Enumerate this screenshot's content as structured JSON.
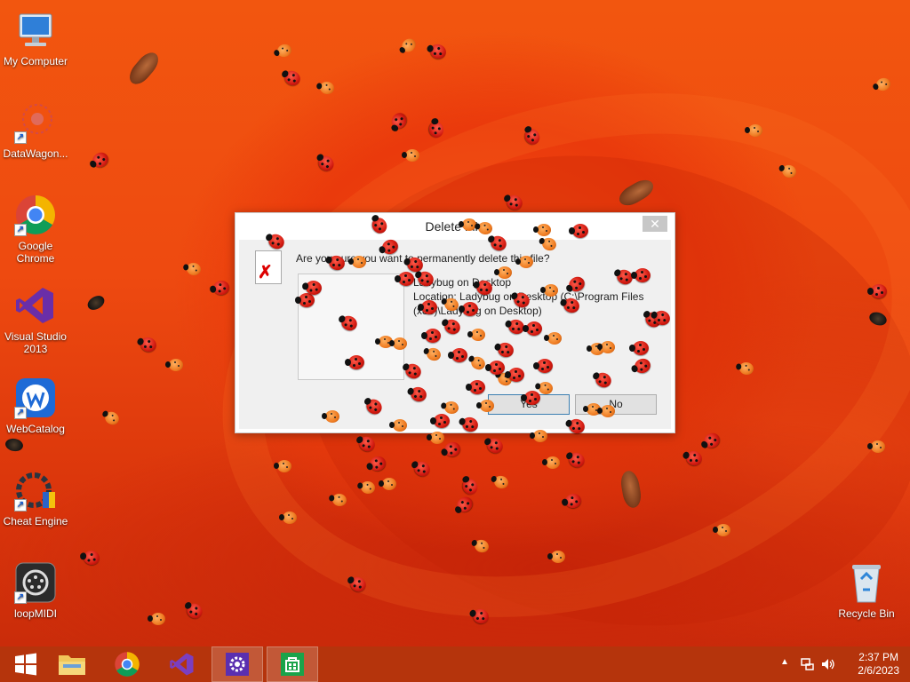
{
  "desktop": {
    "icons": [
      {
        "label": "My Computer",
        "icon": "computer-icon"
      },
      {
        "label": "DataWagon...",
        "icon": "datawagon-icon"
      },
      {
        "label": "Google Chrome",
        "icon": "chrome-icon"
      },
      {
        "label": "Visual Studio 2013",
        "icon": "visual-studio-icon"
      },
      {
        "label": "WebCatalog",
        "icon": "webcatalog-icon"
      },
      {
        "label": "Cheat Engine",
        "icon": "cheat-engine-icon"
      },
      {
        "label": "loopMIDI",
        "icon": "loopmidi-icon"
      },
      {
        "label": "Recycle Bin",
        "icon": "recycle-bin-icon"
      }
    ]
  },
  "dialog": {
    "title": "Delete File",
    "close": "✕",
    "question": "Are you sure you want to permanently delete this file?",
    "file_name": "Ladybug on Desktop",
    "location": "Location: Ladybug on Desktop (C:\\Program Files (x86)\\Ladybug on Desktop)",
    "yes_label": "Yes",
    "no_label": "No"
  },
  "taskbar": {
    "items": [
      {
        "name": "start",
        "icon": "windows-start-icon"
      },
      {
        "name": "file-explorer",
        "icon": "folder-icon"
      },
      {
        "name": "chrome",
        "icon": "chrome-icon"
      },
      {
        "name": "visual-studio",
        "icon": "visual-studio-icon"
      },
      {
        "name": "settings",
        "icon": "gear-icon"
      },
      {
        "name": "store",
        "icon": "store-icon"
      }
    ],
    "clock_time": "2:37 PM",
    "clock_date": "2/6/2023"
  },
  "colors": {
    "accent": "#b5340c",
    "desktop": "#ee4a10",
    "ladybug_red": "#d11a10",
    "ladybug_orange": "#ee7a20"
  }
}
